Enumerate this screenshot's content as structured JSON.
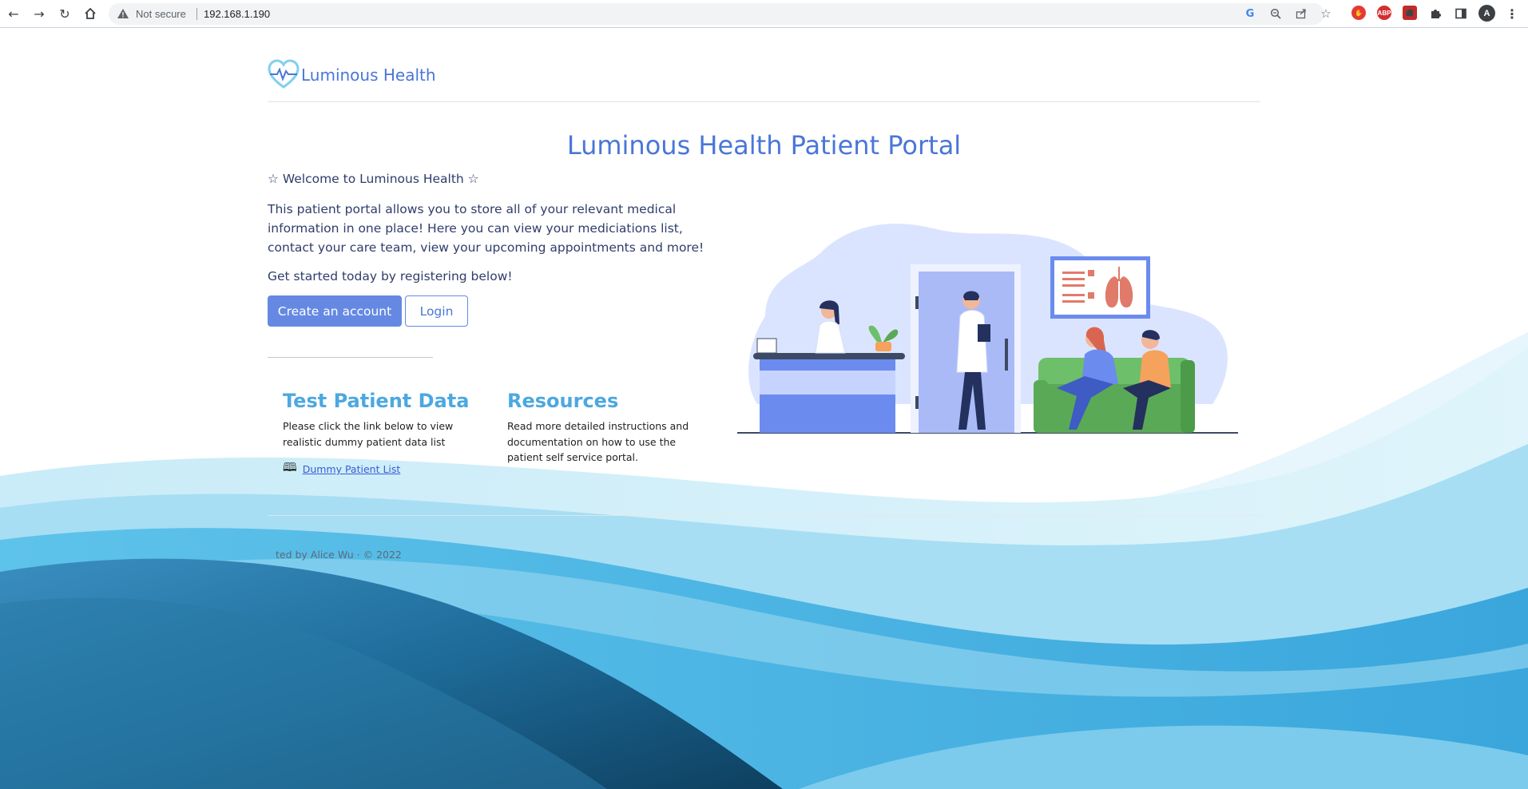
{
  "browser": {
    "security_label": "Not secure",
    "url": "192.168.1.190",
    "profile_initial": "A",
    "extensions": [
      "ABP"
    ]
  },
  "header": {
    "brand": "Luminous Health"
  },
  "main": {
    "title": "Luminous Health Patient Portal",
    "welcome": "☆ Welcome to Luminous Health ☆",
    "intro": "This patient portal allows you to store all of your relevant medical information in one place! Here you can view your mediciations list, contact your care team, view your upcoming appointments and more!",
    "get_started": "Get started today by registering below!",
    "create_account_label": "Create an account",
    "login_label": "Login"
  },
  "cards": [
    {
      "title": "Test Patient Data",
      "text": "Please click the link below to view realistic dummy patient data list",
      "link": "Dummy Patient List"
    },
    {
      "title": "Resources",
      "text": "Read more detailed instructions and documentation on how to use the patient self service portal."
    }
  ],
  "footer": {
    "text": "ted by Alice Wu · © 2022"
  },
  "colors": {
    "brand_blue": "#4a76d8",
    "button_blue": "#6589e3",
    "card_title": "#4ca8e0"
  }
}
